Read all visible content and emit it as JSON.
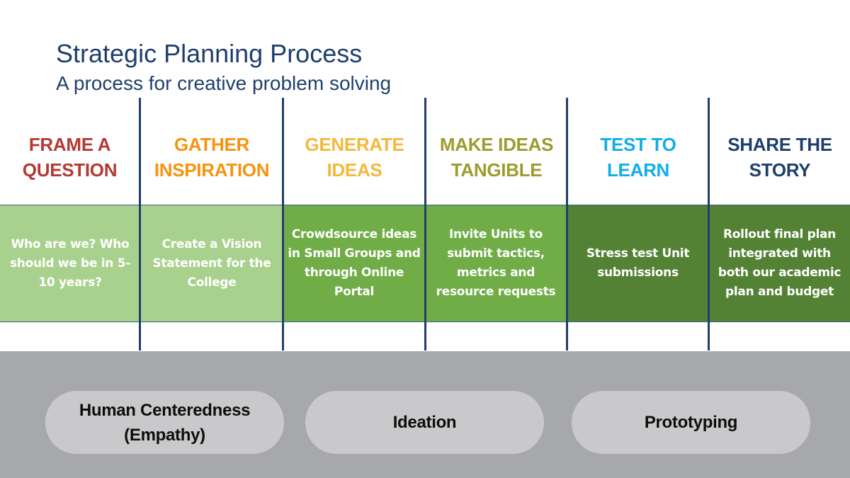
{
  "header": {
    "title": "Strategic Planning Process",
    "subtitle": "A process for creative problem solving"
  },
  "stages": [
    {
      "label_line1": "FRAME A",
      "label_line2": "QUESTION",
      "color": "#b23a35",
      "description": "Who are we? Who should we be in 5-10 years?",
      "fill": "#a9d18e"
    },
    {
      "label_line1": "GATHER",
      "label_line2": "INSPIRATION",
      "color": "#f7930f",
      "description": "Create a Vision Statement for the College",
      "fill": "#a9d18e"
    },
    {
      "label_line1": "GENERATE",
      "label_line2": "IDEAS",
      "color": "#f5b83d",
      "description": "Crowdsource ideas in Small Groups and through Online Portal",
      "fill": "#70ad47"
    },
    {
      "label_line1": "MAKE IDEAS",
      "label_line2": "TANGIBLE",
      "color": "#9c9c2f",
      "description": "Invite Units to submit tactics, metrics and resource requests",
      "fill": "#70ad47"
    },
    {
      "label_line1": "TEST TO",
      "label_line2": "LEARN",
      "color": "#10aee8",
      "description": "Stress test Unit submissions",
      "fill": "#548235"
    },
    {
      "label_line1": "SHARE THE",
      "label_line2": "STORY",
      "color": "#1f3f6b",
      "description": "Rollout final plan integrated with both our academic plan and budget",
      "fill": "#548235"
    }
  ],
  "pillars": [
    {
      "line1": "Human Centeredness",
      "line2": "(Empathy)"
    },
    {
      "line1": "Ideation",
      "line2": ""
    },
    {
      "line1": "Prototyping",
      "line2": ""
    }
  ],
  "colors": {
    "title": "#1f3f6b",
    "divider": "#1f3f6b",
    "gray_band": "#a7a8ab",
    "pill": "#c9c9cb"
  }
}
